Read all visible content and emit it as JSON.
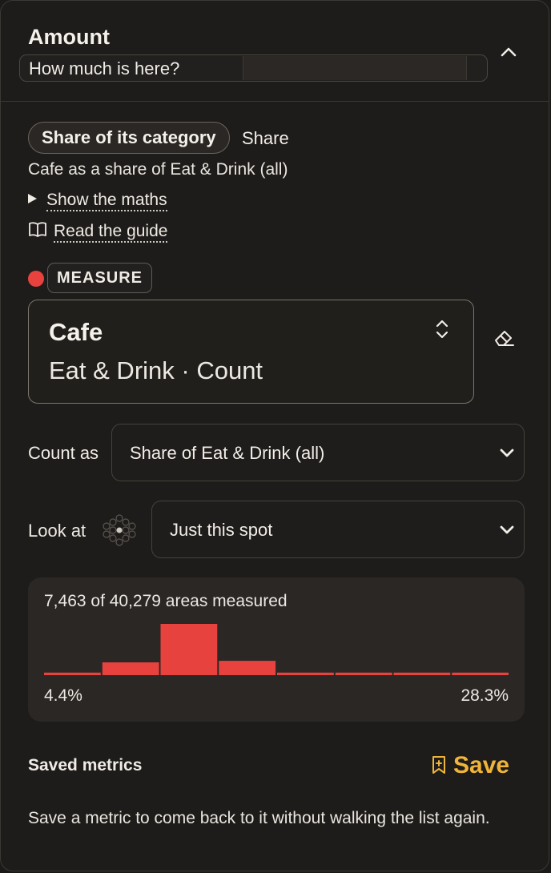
{
  "header": {
    "title": "Amount",
    "subtitle": "How much is here?"
  },
  "mode": {
    "pill_label": "Share of its category",
    "side_label": "Share",
    "description": "Cafe as a share of Eat & Drink (all)",
    "maths_link": "Show the maths",
    "guide_link": "Read the guide"
  },
  "measure": {
    "tag": "MEASURE",
    "color": "#e8423f",
    "name": "Cafe",
    "meta": "Eat & Drink · Count"
  },
  "count_as": {
    "label": "Count as",
    "value": "Share of Eat & Drink (all)"
  },
  "look_at": {
    "label": "Look at",
    "value": "Just this spot"
  },
  "histogram": {
    "caption": "7,463 of 40,279 areas measured",
    "min_label": "4.4%",
    "max_label": "28.3%",
    "bar_color": "#e8423f",
    "relative_heights": [
      0.05,
      0.25,
      1.0,
      0.28,
      0.05,
      0.05,
      0.05,
      0.05
    ]
  },
  "saved": {
    "label": "Saved metrics",
    "save_label": "Save",
    "save_color": "#f0b43a",
    "empty_note": "Save a metric to come back to it without walking the list again."
  },
  "icons": [
    "chevron-up-icon",
    "disclosure-triangle-icon",
    "book-icon",
    "updown-chevron-icon",
    "eraser-icon",
    "chevron-down-icon",
    "hexagon-grid-icon",
    "bookmark-plus-icon"
  ]
}
